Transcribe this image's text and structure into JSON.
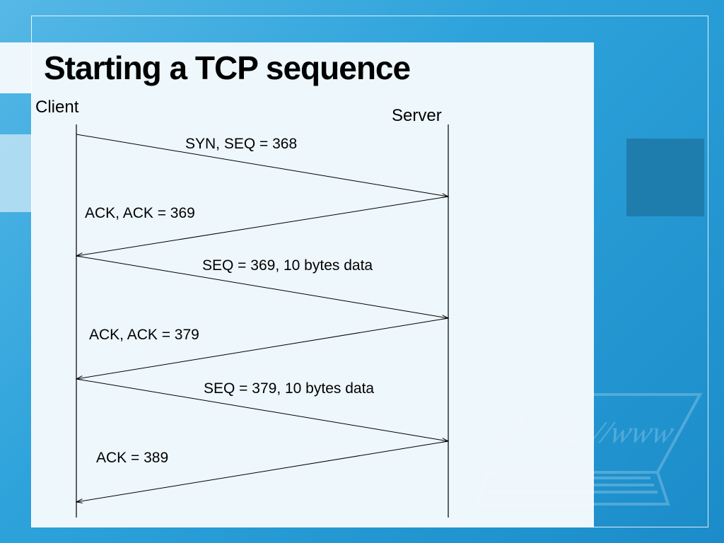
{
  "title": "Starting a TCP sequence",
  "actors": {
    "client": "Client",
    "server": "Server"
  },
  "messages": {
    "m1": "SYN, SEQ = 368",
    "m2": "ACK, ACK = 369",
    "m3": "SEQ = 369,   10 bytes data",
    "m4": "ACK, ACK = 379",
    "m5": "SEQ = 379,   10 bytes data",
    "m6": "ACK = 389"
  },
  "watermark": "http://www"
}
